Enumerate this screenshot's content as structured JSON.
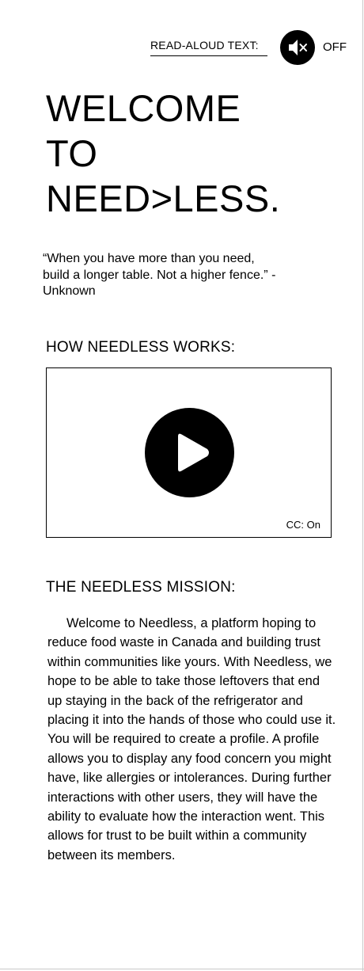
{
  "read_aloud": {
    "label": "READ-ALOUD TEXT:",
    "state": "OFF"
  },
  "welcome": {
    "line1": "WELCOME",
    "line2": "TO",
    "line3": "NEED>LESS."
  },
  "quote": "“When you have more than you need, build a longer table. Not a higher fence.” - Unknown",
  "how_it_works": {
    "heading": "HOW NEEDLESS WORKS:",
    "video": {
      "captions": "CC: On"
    }
  },
  "mission": {
    "heading": "THE NEEDLESS MISSION:",
    "body": "Welcome to Needless, a platform hoping to reduce food waste in Canada and building trust within communities like yours. With Needless, we hope to be able to take those leftovers that end up staying in the back of the refrigerator and placing it into the hands of those who could use it. You will be required to create a profile. A profile allows you to display any food concern you might have, like allergies or intolerances. During further interactions with other users, they will have the ability to evaluate how the interaction went. This allows for trust to be built within a community between its members."
  },
  "icons": {
    "mute": "speaker-muted-icon",
    "play": "play-icon"
  }
}
